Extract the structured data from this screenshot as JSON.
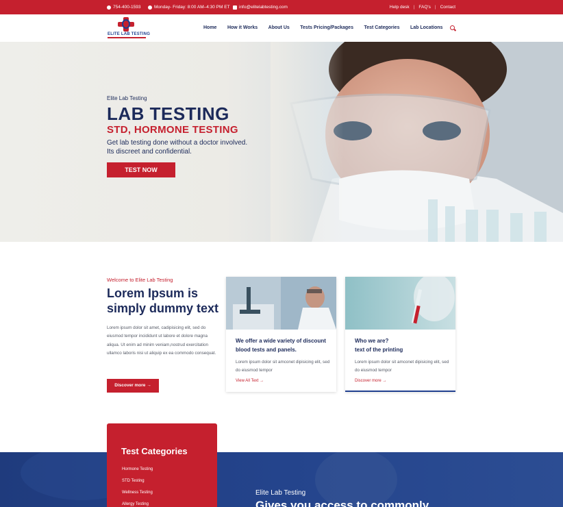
{
  "topbar": {
    "phone": "754-400-1593",
    "hours": "Monday- Friday: 8:00 AM–4:30 PM ET",
    "email": "info@elitelabtesting.com",
    "links": [
      "Help desk",
      "FAQ's",
      "Contact"
    ]
  },
  "header": {
    "logo_text": "ELITE LAB TESTING",
    "nav": [
      "Home",
      "How it Works",
      "About Us",
      "Tests Pricing/Packages",
      "Test Categories",
      "Lab Locations"
    ]
  },
  "hero": {
    "kicker": "Elite Lab Testing",
    "title": "LAB TESTING",
    "subtitle": "STD, HORMONE TESTING",
    "desc_line1": "Get lab testing done without a doctor involved.",
    "desc_line2": "Its discreet and confidential.",
    "cta": "TEST NOW"
  },
  "welcome": {
    "kicker": "Welcome to Elite Lab Testing",
    "title": "Lorem Ipsum is simply dummy text",
    "body": "Lorem ipsum dolor sit amet, cadipisicing elit, sed do eiusmod tempor incididunt ut labore et dolore magna aliqua. Ut enim ad minim veniam,nostrud exercitation ullamco laboris nisi ut aliquip ex ea commodo consequat.",
    "button": "Discover more →"
  },
  "cards": [
    {
      "title": "We offer a wide variety of discount blood tests and panels.",
      "body": "Lorem ipsum dolor sit amconet dipisicing elit, sed do eiusmod tempor",
      "link": "View All Text →"
    },
    {
      "title_line1": "Who we are?",
      "title_line2": "text of the printing",
      "body": "Lorem ipsum dolor sit amconet dipisicing elit, sed do eiusmod tempor",
      "link": "Discover more →"
    }
  ],
  "categories": {
    "title": "Test Categories",
    "items": [
      "Hormone Testing",
      "STD Testing",
      "Wellness Testing",
      "Allergy Testing"
    ]
  },
  "band": {
    "kicker": "Elite Lab Testing",
    "headline": "Gives you access to commonly"
  },
  "colors": {
    "brand_red": "#c5202e",
    "brand_navy": "#1c2a5a",
    "band_blue": "#24448c"
  }
}
